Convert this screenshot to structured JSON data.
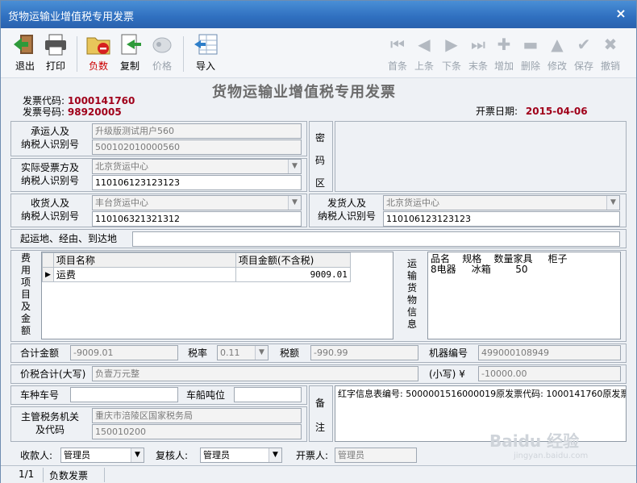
{
  "window": {
    "title": "货物运输业增值税专用发票",
    "close": "×"
  },
  "toolbar": {
    "exit": "退出",
    "print": "打印",
    "negative": "负数",
    "copy": "复制",
    "price": "价格",
    "import": "导入",
    "first": "首条",
    "prev": "上条",
    "next": "下条",
    "last": "末条",
    "add": "增加",
    "delete": "删除",
    "modify": "修改",
    "save": "保存",
    "cancel": "撤销"
  },
  "invoice": {
    "title": "货物运输业增值税专用发票",
    "code_label": "发票代码:",
    "code": "1000141760",
    "number_label": "发票号码:",
    "number": "98920005",
    "date_label": "开票日期:",
    "date": "2015-04-06"
  },
  "carrier": {
    "label1": "承运人及",
    "label2": "纳税人识别号",
    "name": "升级版测试用户560",
    "tax_id": "500102010000560"
  },
  "password_area": {
    "c1": "密",
    "c2": "码",
    "c3": "区"
  },
  "recipient": {
    "label1": "实际受票方及",
    "label2": "纳税人识别号",
    "name": "北京货运中心",
    "tax_id": "110106123123123"
  },
  "consignee": {
    "label1": "收货人及",
    "label2": "纳税人识别号",
    "name": "丰台货运中心",
    "tax_id": "110106321321312"
  },
  "consignor": {
    "label1": "发货人及",
    "label2": "纳税人识别号",
    "name": "北京货运中心",
    "tax_id": "110106123123123"
  },
  "route": {
    "label": "起运地、经由、到达地",
    "value": ""
  },
  "fees": {
    "vlabel": [
      "费",
      "用",
      "项",
      "目",
      "及",
      "金",
      "额"
    ],
    "col_item": "项目名称",
    "col_amount": "项目金额(不含税)",
    "rows": [
      {
        "item": "运费",
        "amount": "9009.01"
      }
    ]
  },
  "cargo": {
    "vlabel": [
      "运",
      "输",
      "货",
      "物",
      "信",
      "息"
    ],
    "line1": "品名    规格    数量家具     柜子",
    "line2": "8电器     冰箱        50"
  },
  "totals": {
    "sum_label": "合计金额",
    "sum": "-9009.01",
    "rate_label": "税率",
    "rate": "0.11",
    "tax_label": "税额",
    "tax": "-990.99",
    "machine_label": "机器编号",
    "machine": "499000108949",
    "words_label": "价税合计(大写)",
    "words": "负壹万元整",
    "small_label": "(小写)",
    "currency": "¥",
    "small": "-10000.00"
  },
  "vehicle": {
    "label": "车种车号",
    "value": "",
    "tonnage_label": "车船吨位",
    "tonnage": ""
  },
  "authority": {
    "label1": "主管税务机关",
    "label2": "及代码",
    "name": "重庆市涪陵区国家税务局",
    "code": "150010200"
  },
  "remarks": {
    "c1": "备",
    "c2": "注",
    "text": "红字信息表编号: 5000001516000019原发票代码: 1000141760原发票"
  },
  "people": {
    "payee_label": "收款人:",
    "payee": "管理员",
    "reviewer_label": "复核人:",
    "reviewer": "管理员",
    "issuer_label": "开票人:",
    "issuer": "管理员"
  },
  "status": {
    "page": "1/1",
    "type": "负数发票"
  },
  "watermark": {
    "brand": "Baidu 经验",
    "site": "jingyan.baidu.com"
  }
}
